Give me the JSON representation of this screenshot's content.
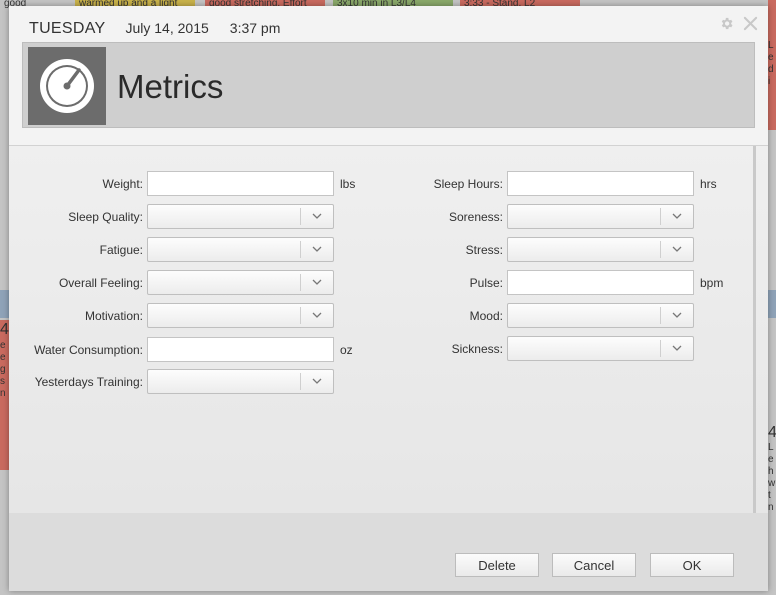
{
  "background": {
    "top_snippets": [
      "good",
      "warmed up and a light",
      "good stretching. Effort",
      "3x10 min in L3/L4",
      "3:33 - Stand, L2"
    ],
    "left_snippets": [
      "4",
      "e",
      "e",
      "g",
      "s",
      "n"
    ],
    "right_snippets": [
      "L",
      "e",
      "d",
      "i",
      "4",
      "L",
      "e",
      "h",
      "w",
      "t",
      "n"
    ]
  },
  "header": {
    "day": "TUESDAY",
    "date": "July 14, 2015",
    "time": "3:37 pm",
    "settings_icon": "gear-icon",
    "close_icon": "close-icon",
    "title": "Metrics",
    "title_icon": "gauge-icon"
  },
  "form": {
    "left": [
      {
        "label": "Weight:",
        "type": "input",
        "value": "",
        "unit": "lbs"
      },
      {
        "label": "Sleep Quality:",
        "type": "select",
        "value": ""
      },
      {
        "label": "Fatigue:",
        "type": "select",
        "value": ""
      },
      {
        "label": "Overall Feeling:",
        "type": "select",
        "value": ""
      },
      {
        "label": "Motivation:",
        "type": "select",
        "value": ""
      },
      {
        "label": "Water Consumption:",
        "type": "input",
        "value": "",
        "unit": "oz"
      },
      {
        "label": "Yesterdays Training:",
        "type": "select",
        "value": ""
      }
    ],
    "right": [
      {
        "label": "Sleep Hours:",
        "type": "input",
        "value": "",
        "unit": "hrs"
      },
      {
        "label": "Soreness:",
        "type": "select",
        "value": ""
      },
      {
        "label": "Stress:",
        "type": "select",
        "value": ""
      },
      {
        "label": "Pulse:",
        "type": "input",
        "value": "",
        "unit": "bpm"
      },
      {
        "label": "Mood:",
        "type": "select",
        "value": ""
      },
      {
        "label": "Sickness:",
        "type": "select",
        "value": ""
      }
    ]
  },
  "buttons": {
    "delete": "Delete",
    "cancel": "Cancel",
    "ok": "OK"
  },
  "colors": {
    "background_dim": "#c4c4c4",
    "dialog": "#ececec",
    "banner": "#cfcfcf",
    "icon_box": "#6c6c6c",
    "bg_yellow": "#c9b24a",
    "bg_red": "#c96a5f",
    "bg_green": "#8aa86a",
    "bg_blue": "#8fa3b8"
  }
}
